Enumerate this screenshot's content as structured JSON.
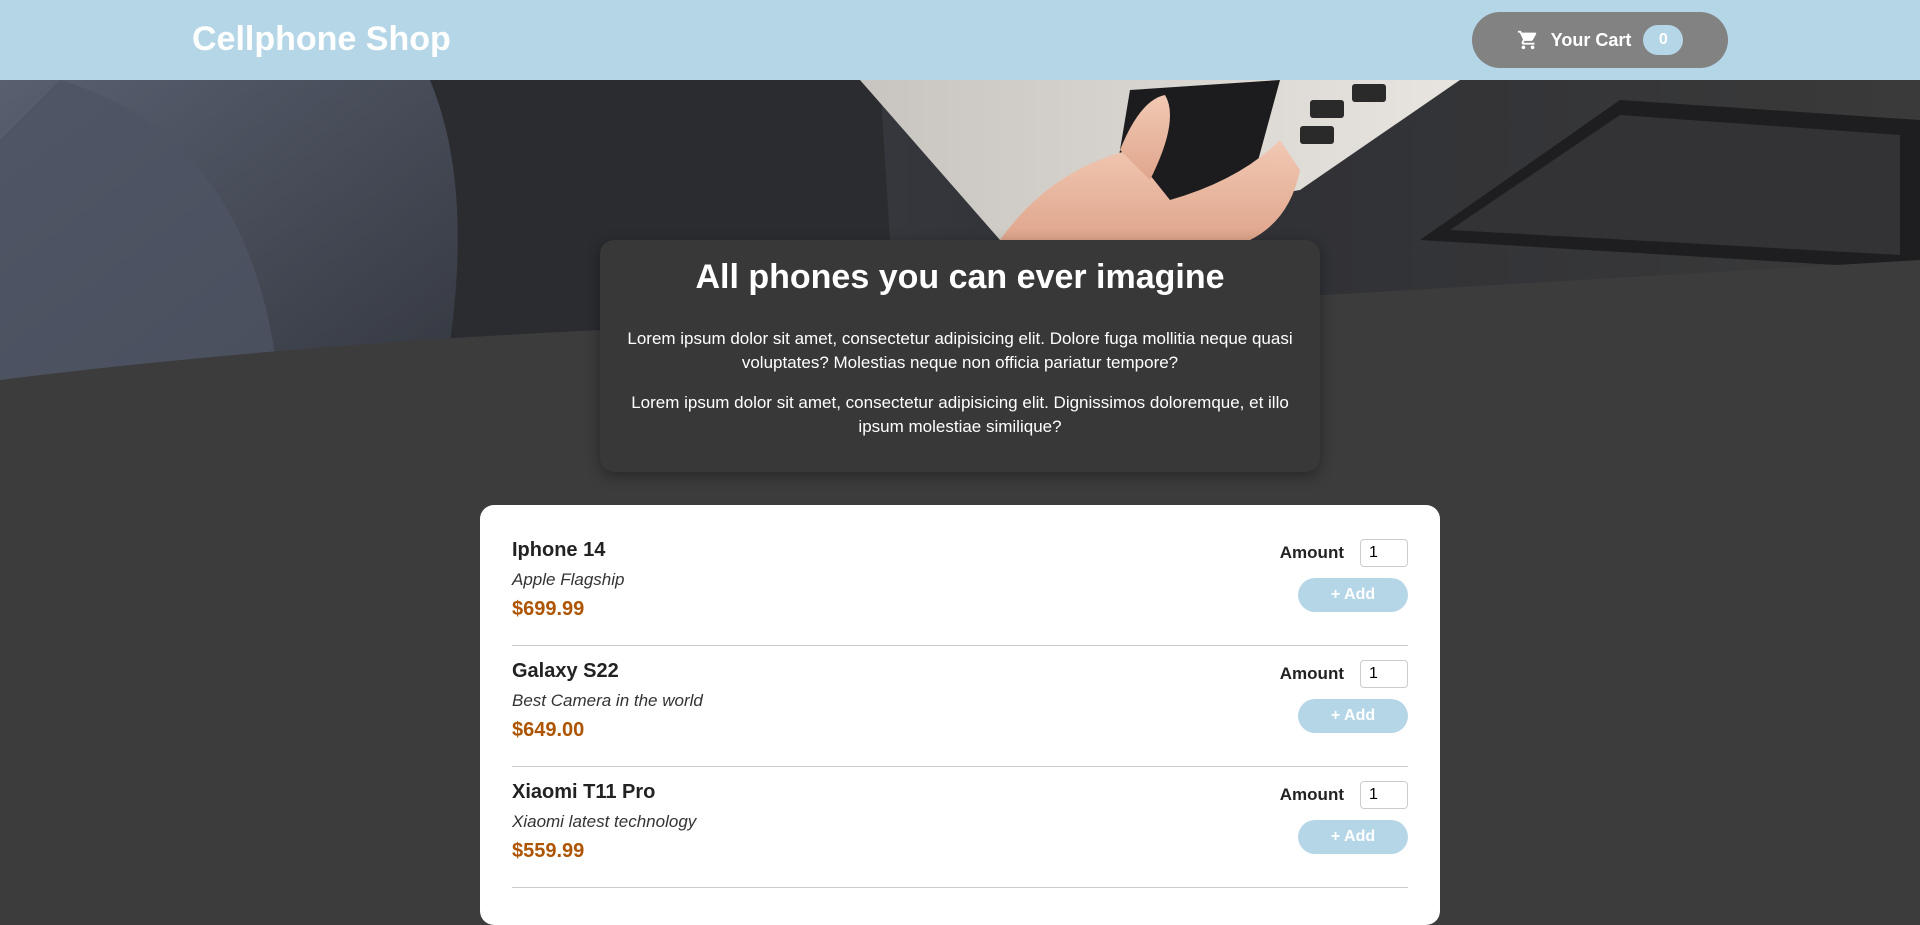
{
  "header": {
    "brand": "Cellphone Shop",
    "cart_label": "Your Cart",
    "cart_count": "0",
    "cart_icon": "cart-icon"
  },
  "intro": {
    "title": "All phones you can ever imagine",
    "paragraph_1": "Lorem ipsum dolor sit amet, consectetur adipisicing elit. Dolore fuga mollitia neque quasi voluptates? Molestias neque non officia pariatur tempore?",
    "paragraph_2": "Lorem ipsum dolor sit amet, consectetur adipisicing elit. Dignissimos doloremque, et illo ipsum molestiae similique?"
  },
  "products": [
    {
      "name": "Iphone 14",
      "description": "Apple Flagship",
      "price": "$699.99",
      "amount_label": "Amount",
      "amount": "1",
      "add_label": "+ Add"
    },
    {
      "name": "Galaxy S22",
      "description": "Best Camera in the world",
      "price": "$649.00",
      "amount_label": "Amount",
      "amount": "1",
      "add_label": "+ Add"
    },
    {
      "name": "Xiaomi T11 Pro",
      "description": "Xiaomi latest technology",
      "price": "$559.99",
      "amount_label": "Amount",
      "amount": "1",
      "add_label": "+ Add"
    }
  ],
  "colors": {
    "header_bg": "#b5d6e7",
    "page_bg": "#3c3c3c",
    "price": "#ad5502",
    "button": "#b5d6e7",
    "cart_button": "#828282"
  }
}
